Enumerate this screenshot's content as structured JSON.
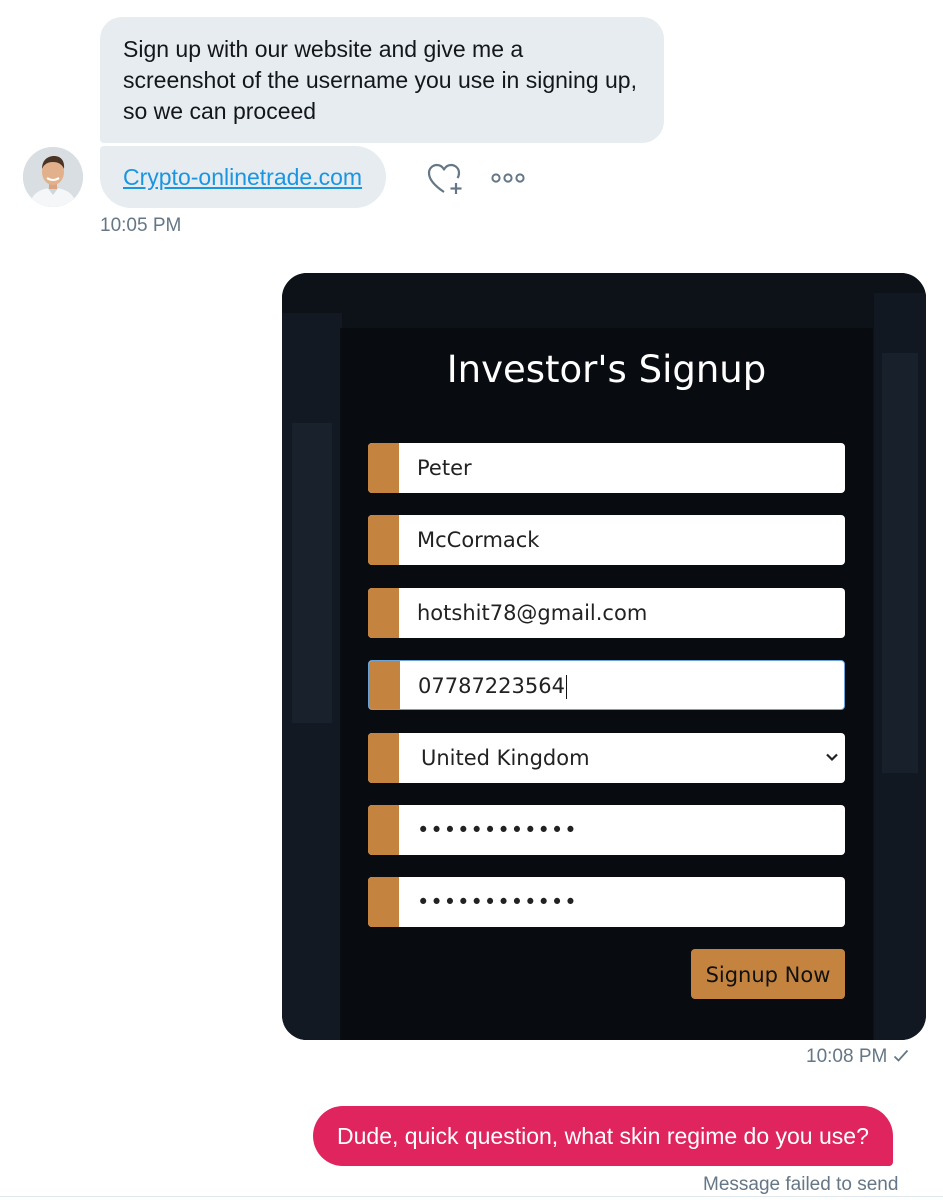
{
  "conversation": {
    "incoming": {
      "message_1": "Sign up with our website and give me a screenshot of the username you use in signing up, so we can proceed",
      "message_2_link": "Crypto-onlinetrade.com",
      "timestamp": "10:05 PM",
      "actions": {
        "like_icon": "heart-plus-icon",
        "more_icon": "more-horizontal-icon"
      }
    },
    "outgoing": {
      "screenshot_timestamp": "10:08 PM",
      "screenshot_status_icon": "checkmark-icon",
      "message": "Dude, quick question, what skin regime do you use?",
      "status": "Message failed to send"
    }
  },
  "signup_form": {
    "title": "Investor's Signup",
    "fields": [
      {
        "name": "first-name",
        "value": "Peter"
      },
      {
        "name": "last-name",
        "value": "McCormack"
      },
      {
        "name": "email",
        "value": "hotshit78@gmail.com"
      },
      {
        "name": "phone",
        "value": "07787223564"
      },
      {
        "name": "country",
        "value": "United Kingdom"
      },
      {
        "name": "password",
        "value": "••••••••••••"
      },
      {
        "name": "confirm-password",
        "value": "••••••••••••"
      }
    ],
    "submit_label": "Signup Now"
  },
  "colors": {
    "incoming_bubble": "#e6ecf0",
    "outgoing_bubble": "#e0245e",
    "link": "#1b95e0",
    "form_accent": "#c4843f",
    "form_background": "#0c1016"
  }
}
